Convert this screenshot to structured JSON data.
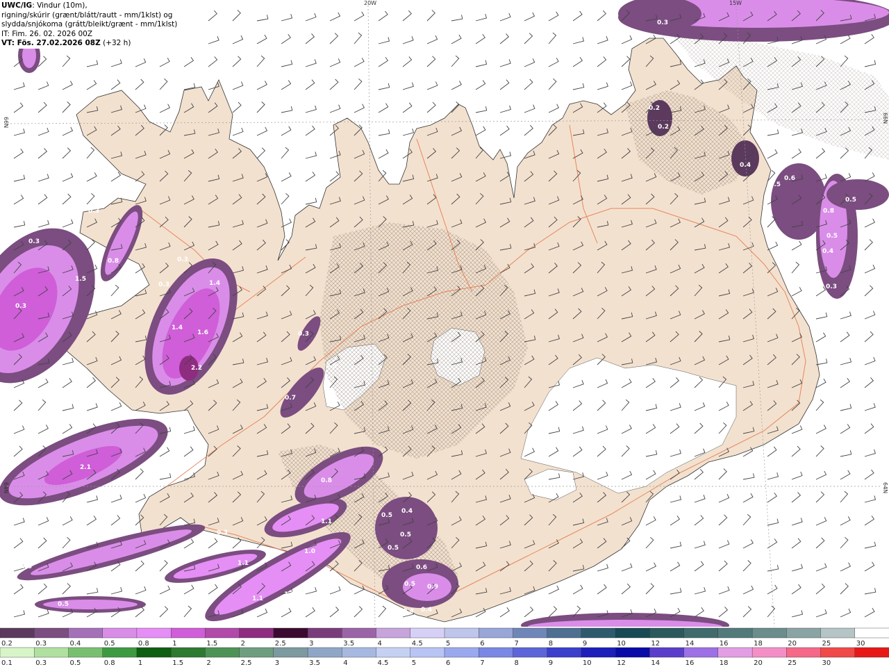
{
  "title": {
    "model": "UWC/IG",
    "desc1": ": Vindur (10m),",
    "desc2": "rigning/skúrir (grænt/blátt/rautt - mm/1klst) og",
    "desc3": "slydda/snjókoma (grátt/bleikt/grænt - mm/1klst)",
    "init": "IT: Fim. 26. 02. 2026 00Z",
    "valid": "VT: Fös. 27.02.2026 08Z",
    "lead": " (+32 h)"
  },
  "graticule": {
    "lon_20w": "20W",
    "lon_15w": "15W",
    "lat_66n_left": "66N",
    "lat_66n_right": "66N",
    "lat_64n_left": "64N",
    "lat_64n_right": "64N"
  },
  "precip_labels": [
    "0.3",
    "0.2",
    "0.2",
    "0.4",
    "0.5",
    "0.6",
    "0.8",
    "0.5",
    "0.5",
    "0.4",
    "0.3",
    "0.3",
    "0.3",
    "0.3",
    "0.8",
    "0.3",
    "1.5",
    "0.3",
    "1.4",
    "1.4",
    "1.6",
    "2.2",
    "0.3",
    "0.5",
    "0.7",
    "2.1",
    "0.8",
    "1.1",
    "0.3",
    "0.4",
    "1.0",
    "0.6",
    "1.1",
    "1.1",
    "1.2",
    "0.5",
    "0.5",
    "0.4",
    "0.5",
    "0.5",
    "0.6",
    "0.5",
    "0.9",
    "0.4",
    "0.4",
    "0.3"
  ],
  "legend": {
    "snow_scale": [
      "0.2",
      "0.3",
      "0.4",
      "0.5",
      "0.8",
      "1",
      "1.5",
      "2",
      "2.5",
      "3",
      "3.5",
      "4",
      "4.5",
      "5",
      "6",
      "7",
      "8",
      "9",
      "10",
      "12",
      "14",
      "16",
      "18",
      "20",
      "25",
      "30"
    ],
    "rain_scale": [
      "0.1",
      "0.3",
      "0.5",
      "0.8",
      "1",
      "1.5",
      "2",
      "2.5",
      "3",
      "3.5",
      "4",
      "4.5",
      "5",
      "6",
      "7",
      "8",
      "9",
      "10",
      "12",
      "14",
      "16",
      "18",
      "20",
      "25",
      "30"
    ],
    "snow_colors": [
      "#5c3a5e",
      "#7b4d80",
      "#a470b8",
      "#d98de8",
      "#e58ef5",
      "#cf5ed8",
      "#b24aaa",
      "#8e2c80",
      "#3c0a30",
      "#7a3d7b",
      "#9c64a8",
      "#c7a4dc",
      "#d7d0f6",
      "#bfc6ec",
      "#98a6d8",
      "#6f86b8",
      "#4d6f92",
      "#2e5a6e",
      "#174a54",
      "#2b5a5d",
      "#3f6b6c",
      "#527a7a",
      "#6b8d8c",
      "#8aa4a3",
      "#b5c5c5",
      "#ffffff"
    ],
    "rain_colors": [
      "#d8f5c8",
      "#b0e0a0",
      "#78c070",
      "#3e9a40",
      "#0f5f12",
      "#2d7a30",
      "#4e9356",
      "#6f9e7f",
      "#7c9aa0",
      "#8fa6c6",
      "#a7b8e0",
      "#c5d0f3",
      "#b8c4f3",
      "#9aa8ee",
      "#7a87e4",
      "#5d66d8",
      "#3a3fcc",
      "#1c1fba",
      "#0a0aa8",
      "#5a3ecb",
      "#9d70e6",
      "#e39ee3",
      "#f48ec7",
      "#f56888",
      "#f14848",
      "#e81818"
    ]
  }
}
